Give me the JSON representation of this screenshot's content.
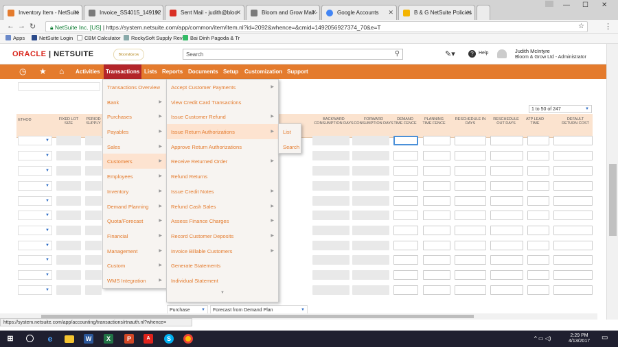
{
  "browser": {
    "tabs": [
      {
        "label": "Inventory Item - NetSuite",
        "fav": "#e47b2d",
        "active": true
      },
      {
        "label": "Invoice_SS4015_149192",
        "fav": "#7a7a7a"
      },
      {
        "label": "Sent Mail - judith@bloo",
        "fav": "#d93025"
      },
      {
        "label": "Bloom and Grow Mail - ",
        "fav": "#7a7a7a"
      },
      {
        "label": "Google Accounts",
        "fav": "#4285f4"
      },
      {
        "label": "B & G NetSuite Policies",
        "fav": "#f4b400"
      }
    ],
    "url_secure": "NetSuite Inc. [US]",
    "url": "https://system.netsuite.com/app/common/item/item.nl?id=2092&whence=&cmid=1492056927374_70&e=T",
    "bookmarks": [
      "Apps",
      "NetSuite Login",
      "CBM Calculator",
      "RockySoft Supply Rev",
      "Bai Dinh Pagoda & Tr"
    ]
  },
  "header": {
    "logo_oracle": "ORACLE",
    "logo_netsuite": "NETSUITE",
    "brand_logo_text": "Bloom&Grow",
    "search_placeholder": "Search",
    "help": "Help",
    "user_name": "Judith McIntyre",
    "user_role": "Bloom & Grow Ltd - Administrator"
  },
  "menubar": {
    "items": [
      "Activities",
      "Transactions",
      "Lists",
      "Reports",
      "Documents",
      "Setup",
      "Customization",
      "Support"
    ]
  },
  "grid": {
    "pager": "1 to 50 of 247",
    "columns": [
      "ETHOD",
      "FIXED LOT SIZE",
      "PERIOD SUPPLY",
      "BACKWARD CONSUMPTION DAYS",
      "FORWARD CONSUMPTION DAYS",
      "DEMAND TIME FENCE",
      "PLANNING TIME FENCE",
      "RESCHEDULE IN DAYS",
      "RESCHEDULE OUT DAYS",
      "ATP LEAD TIME",
      "DEFAULT RETURN COST"
    ],
    "last_row_source": "Purchase",
    "last_row_method": "Forecast from Demand Plan"
  },
  "menu_l1": [
    "Transactions Overview",
    "Bank",
    "Purchases",
    "Payables",
    "Sales",
    "Customers",
    "Employees",
    "Inventory",
    "Demand Planning",
    "Quota/Forecast",
    "Financial",
    "Management",
    "Custom",
    "WMS Integration"
  ],
  "menu_l2": [
    "Accept Customer Payments",
    "View Credit Card Transactions",
    "Issue Customer Refund",
    "Issue Return Authorizations",
    "Approve Return Authorizations",
    "Receive Returned Order",
    "Refund Returns",
    "Issue Credit Notes",
    "Refund Cash Sales",
    "Assess Finance Charges",
    "Record Customer Deposits",
    "Invoice Billable Customers",
    "Generate Statements",
    "Individual Statement"
  ],
  "menu_l3": [
    "List",
    "Search"
  ],
  "status_url": "https://system.netsuite.com/app/accounting/transactions/rtnauth.nl?whence=",
  "clock": {
    "time": "2:29 PM",
    "date": "4/13/2017"
  }
}
